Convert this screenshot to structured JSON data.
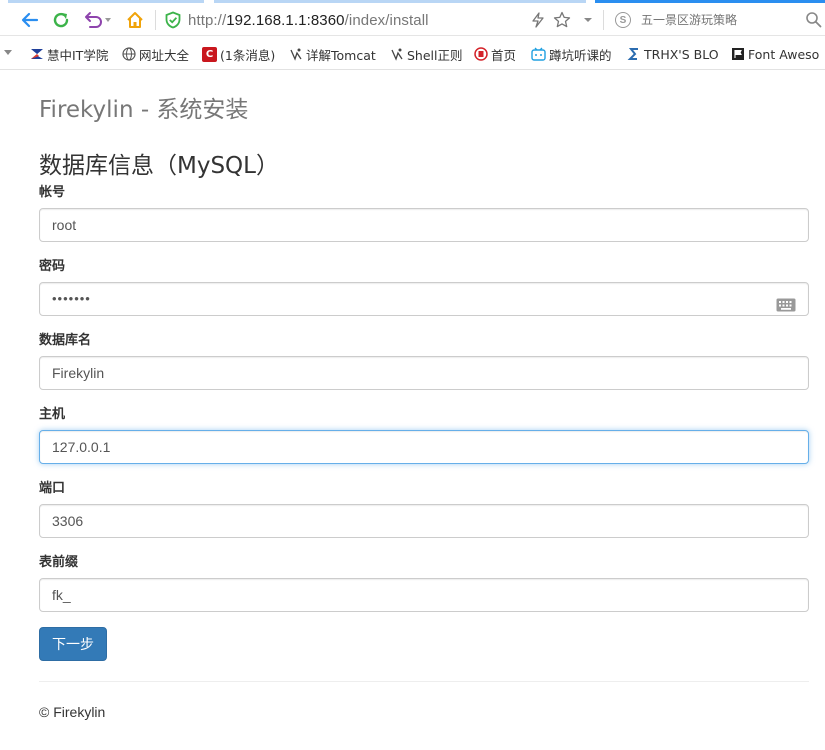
{
  "browser": {
    "url_scheme": "http://",
    "url_host": "192.168.1.1:8360",
    "url_path": "/index/install",
    "search_placeholder": "五一景区游玩策略",
    "accent_color": "#2a8ef0"
  },
  "bookmarks": [
    {
      "label": "慧中IT学院",
      "icon": "hzit-icon"
    },
    {
      "label": "网址大全",
      "icon": "globe-icon"
    },
    {
      "label": "(1条消息)",
      "icon": "csdn-icon"
    },
    {
      "label": "详解Tomcat",
      "icon": "bookmark-icon"
    },
    {
      "label": "Shell正则",
      "icon": "bookmark-icon"
    },
    {
      "label": "首页",
      "icon": "home-logo-icon"
    },
    {
      "label": "蹲坑听课的",
      "icon": "bilibili-icon"
    },
    {
      "label": "TRHX'S BLO",
      "icon": "trhx-icon"
    },
    {
      "label": "Font Aweso",
      "icon": "flag-icon"
    }
  ],
  "page": {
    "app_title": "Firekylin - 系统安装",
    "section_title": "数据库信息（MySQL）",
    "fields": {
      "account": {
        "label": "帐号",
        "value": "root"
      },
      "password": {
        "label": "密码",
        "value": "•••••••"
      },
      "database": {
        "label": "数据库名",
        "value": "Firekylin"
      },
      "host": {
        "label": "主机",
        "value": "127.0.0.1"
      },
      "port": {
        "label": "端口",
        "value": "3306"
      },
      "prefix": {
        "label": "表前缀",
        "value": "fk_"
      }
    },
    "next_label": "下一步",
    "footer": "© Firekylin",
    "primary_color": "#337ab7"
  }
}
